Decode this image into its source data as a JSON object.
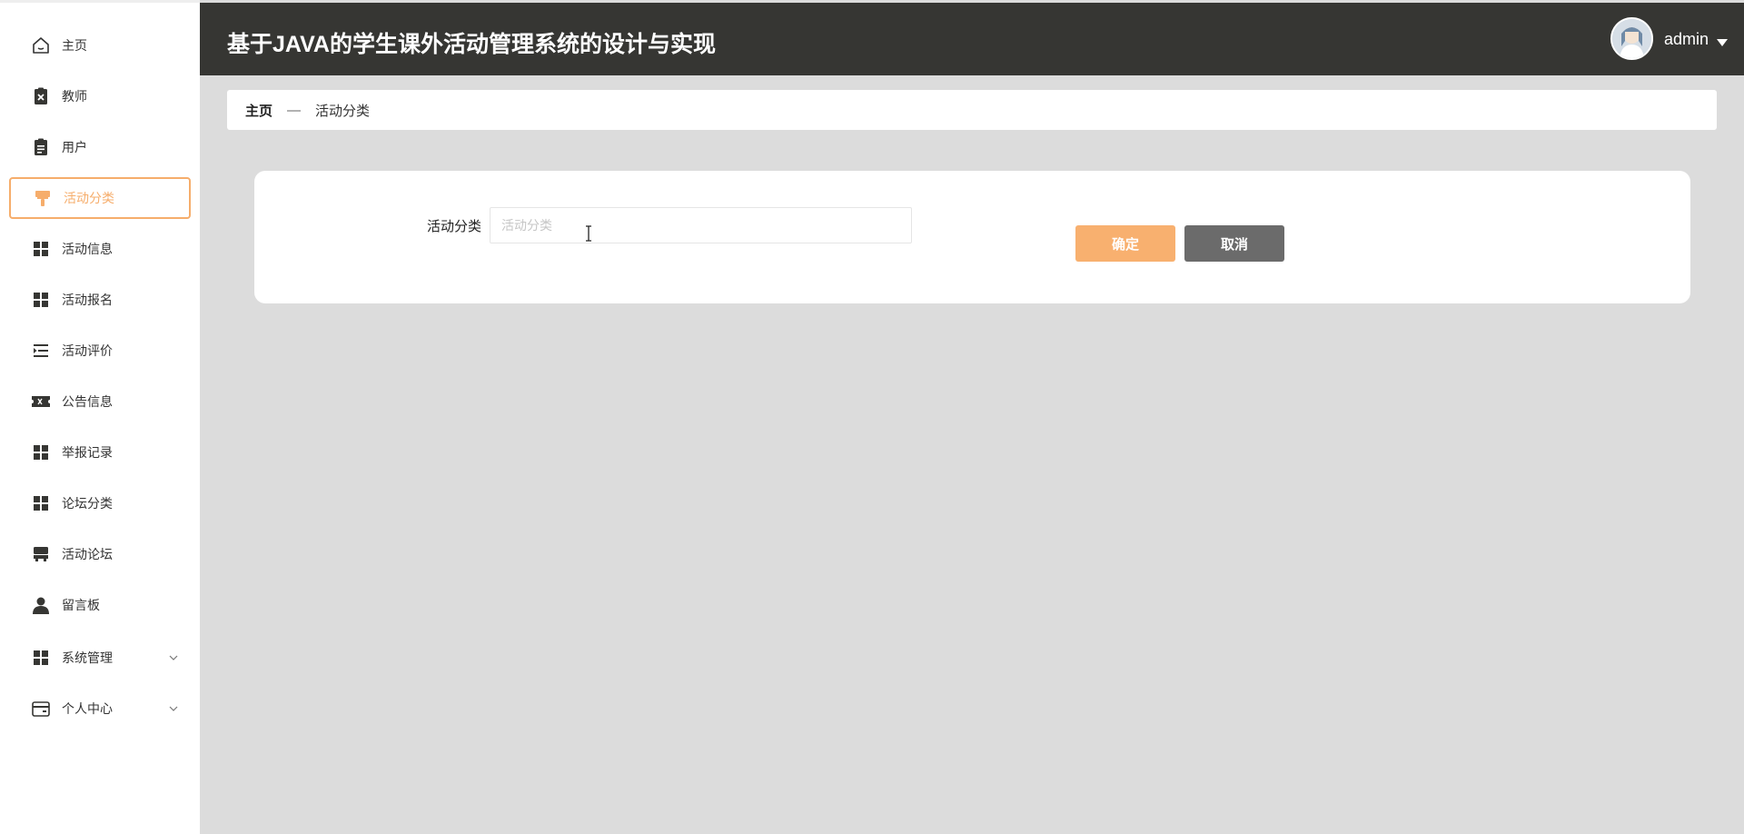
{
  "app": {
    "title": "基于JAVA的学生课外活动管理系统的设计与实现"
  },
  "user": {
    "name": "admin"
  },
  "colors": {
    "accent": "#f6ad6b",
    "sidebar_bg": "#ffffff",
    "topbar_bg": "#363633",
    "page_bg": "#dcdcdc",
    "cancel_bg": "#6b6b6b"
  },
  "sidebar": {
    "items": [
      {
        "label": "主页",
        "icon": "home-icon"
      },
      {
        "label": "教师",
        "icon": "clipboard-x-icon"
      },
      {
        "label": "用户",
        "icon": "clipboard-icon"
      },
      {
        "label": "活动分类",
        "icon": "paint-roller-icon",
        "active": true
      },
      {
        "label": "活动信息",
        "icon": "grid-icon"
      },
      {
        "label": "活动报名",
        "icon": "grid-icon"
      },
      {
        "label": "活动评价",
        "icon": "list-indent-icon"
      },
      {
        "label": "公告信息",
        "icon": "ticket-icon"
      },
      {
        "label": "举报记录",
        "icon": "grid-icon"
      },
      {
        "label": "论坛分类",
        "icon": "grid-icon"
      },
      {
        "label": "活动论坛",
        "icon": "store-icon"
      },
      {
        "label": "留言板",
        "icon": "person-icon"
      },
      {
        "label": "系统管理",
        "icon": "grid-icon",
        "expandable": true
      },
      {
        "label": "个人中心",
        "icon": "wallet-icon",
        "expandable": true
      }
    ]
  },
  "breadcrumb": {
    "home": "主页",
    "separator": "—",
    "current": "活动分类"
  },
  "form": {
    "field_label": "活动分类",
    "field_placeholder": "活动分类",
    "field_value": "",
    "confirm_label": "确定",
    "cancel_label": "取消"
  }
}
